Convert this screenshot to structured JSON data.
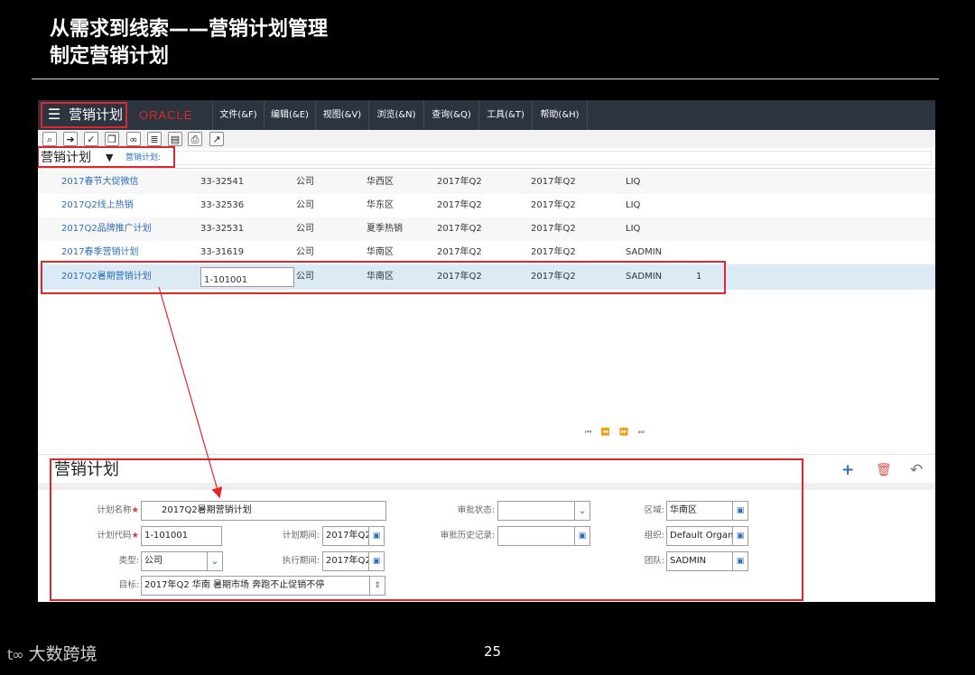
{
  "slide": {
    "title_line1": "从需求到线索——营销计划管理",
    "title_line2": "制定营销计划",
    "page_number": "25",
    "footer_logo_mark": "t∞",
    "footer_logo_text": "大数跨境"
  },
  "menubar": {
    "app_title": "营销计划",
    "logo": "ORACLE",
    "items": [
      "文件(&F)",
      "编辑(&E)",
      "视图(&V)",
      "浏览(&N)",
      "查询(&Q)",
      "工具(&T)",
      "帮助(&H)"
    ]
  },
  "toolbar": {
    "icons": [
      "search-icon",
      "go-icon",
      "clipboard-icon",
      "copy-icon",
      "link-icon",
      "list-icon",
      "document-icon",
      "print-icon",
      "chart-icon"
    ]
  },
  "query": {
    "title": "营销计划",
    "field_label": "营销计划:"
  },
  "list": {
    "rows": [
      {
        "name": "2017春节大促微信",
        "code": "33-32541",
        "type": "公司",
        "region": "华西区",
        "period": "2017年Q2",
        "exec": "2017年Q2",
        "owner": "LIQ",
        "extra": ""
      },
      {
        "name": "2017Q2线上热销",
        "code": "33-32536",
        "type": "公司",
        "region": "华东区",
        "period": "2017年Q2",
        "exec": "2017年Q2",
        "owner": "LIQ",
        "extra": ""
      },
      {
        "name": "2017Q2品牌推广计划",
        "code": "33-32531",
        "type": "公司",
        "region": "夏季热销",
        "period": "2017年Q2",
        "exec": "2017年Q2",
        "owner": "LIQ",
        "extra": ""
      },
      {
        "name": "2017春季营销计划",
        "code": "33-31619",
        "type": "公司",
        "region": "华南区",
        "period": "2017年Q2",
        "exec": "2017年Q2",
        "owner": "SADMIN",
        "extra": ""
      },
      {
        "name": "2017Q2暑期营销计划",
        "code": "1-101001",
        "type": "公司",
        "region": "华南区",
        "period": "2017年Q2",
        "exec": "2017年Q2",
        "owner": "SADMIN",
        "extra": "1"
      }
    ],
    "pager": "⏮ ⏪ ⏩ ⏭"
  },
  "form": {
    "title": "营销计划",
    "add_icon": "+",
    "delete_icon": "🗑",
    "undo_icon": "↶",
    "plan_name_label": "计划名称",
    "plan_name_value": "2017Q2暑期营销计划",
    "plan_code_label": "计划代码",
    "plan_code_value": "1-101001",
    "type_label": "类型:",
    "type_value": "公司",
    "goal_label": "目标:",
    "goal_value": "2017年Q2 华南 暑期市场 奔跑不止促销不停",
    "period_label": "计划期间:",
    "period_value": "2017年Q2",
    "exec_label": "执行期间:",
    "exec_value": "2017年Q2",
    "approval_status_label": "审批状态:",
    "approval_status_value": "",
    "approval_history_label": "审批历史记录:",
    "approval_history_value": "",
    "region_label": "区域:",
    "region_value": "华南区",
    "org_label": "组织:",
    "org_value": "Default Organization",
    "team_label": "团队:",
    "team_value": "SADMIN",
    "required_mark": "★"
  },
  "colors": {
    "highlight_box": "#e0262a",
    "menubar_bg": "#2c3440",
    "link": "#2a6ebb",
    "selected_row": "#dceaf6"
  }
}
